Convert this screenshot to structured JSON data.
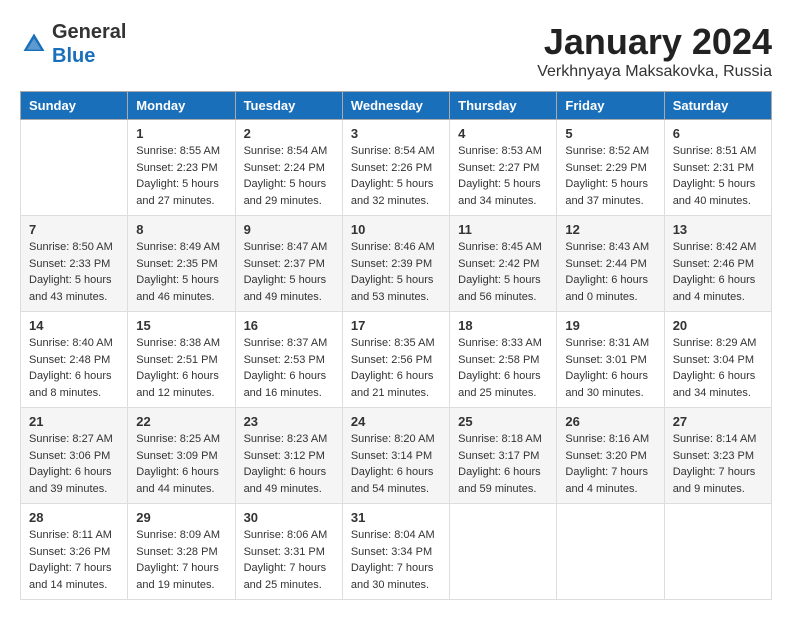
{
  "header": {
    "logo_line1": "General",
    "logo_line2": "Blue",
    "month": "January 2024",
    "location": "Verkhnyaya Maksakovka, Russia"
  },
  "weekdays": [
    "Sunday",
    "Monday",
    "Tuesday",
    "Wednesday",
    "Thursday",
    "Friday",
    "Saturday"
  ],
  "weeks": [
    [
      {
        "day": "",
        "sunrise": "",
        "sunset": "",
        "daylight": ""
      },
      {
        "day": "1",
        "sunrise": "Sunrise: 8:55 AM",
        "sunset": "Sunset: 2:23 PM",
        "daylight": "Daylight: 5 hours and 27 minutes."
      },
      {
        "day": "2",
        "sunrise": "Sunrise: 8:54 AM",
        "sunset": "Sunset: 2:24 PM",
        "daylight": "Daylight: 5 hours and 29 minutes."
      },
      {
        "day": "3",
        "sunrise": "Sunrise: 8:54 AM",
        "sunset": "Sunset: 2:26 PM",
        "daylight": "Daylight: 5 hours and 32 minutes."
      },
      {
        "day": "4",
        "sunrise": "Sunrise: 8:53 AM",
        "sunset": "Sunset: 2:27 PM",
        "daylight": "Daylight: 5 hours and 34 minutes."
      },
      {
        "day": "5",
        "sunrise": "Sunrise: 8:52 AM",
        "sunset": "Sunset: 2:29 PM",
        "daylight": "Daylight: 5 hours and 37 minutes."
      },
      {
        "day": "6",
        "sunrise": "Sunrise: 8:51 AM",
        "sunset": "Sunset: 2:31 PM",
        "daylight": "Daylight: 5 hours and 40 minutes."
      }
    ],
    [
      {
        "day": "7",
        "sunrise": "Sunrise: 8:50 AM",
        "sunset": "Sunset: 2:33 PM",
        "daylight": "Daylight: 5 hours and 43 minutes."
      },
      {
        "day": "8",
        "sunrise": "Sunrise: 8:49 AM",
        "sunset": "Sunset: 2:35 PM",
        "daylight": "Daylight: 5 hours and 46 minutes."
      },
      {
        "day": "9",
        "sunrise": "Sunrise: 8:47 AM",
        "sunset": "Sunset: 2:37 PM",
        "daylight": "Daylight: 5 hours and 49 minutes."
      },
      {
        "day": "10",
        "sunrise": "Sunrise: 8:46 AM",
        "sunset": "Sunset: 2:39 PM",
        "daylight": "Daylight: 5 hours and 53 minutes."
      },
      {
        "day": "11",
        "sunrise": "Sunrise: 8:45 AM",
        "sunset": "Sunset: 2:42 PM",
        "daylight": "Daylight: 5 hours and 56 minutes."
      },
      {
        "day": "12",
        "sunrise": "Sunrise: 8:43 AM",
        "sunset": "Sunset: 2:44 PM",
        "daylight": "Daylight: 6 hours and 0 minutes."
      },
      {
        "day": "13",
        "sunrise": "Sunrise: 8:42 AM",
        "sunset": "Sunset: 2:46 PM",
        "daylight": "Daylight: 6 hours and 4 minutes."
      }
    ],
    [
      {
        "day": "14",
        "sunrise": "Sunrise: 8:40 AM",
        "sunset": "Sunset: 2:48 PM",
        "daylight": "Daylight: 6 hours and 8 minutes."
      },
      {
        "day": "15",
        "sunrise": "Sunrise: 8:38 AM",
        "sunset": "Sunset: 2:51 PM",
        "daylight": "Daylight: 6 hours and 12 minutes."
      },
      {
        "day": "16",
        "sunrise": "Sunrise: 8:37 AM",
        "sunset": "Sunset: 2:53 PM",
        "daylight": "Daylight: 6 hours and 16 minutes."
      },
      {
        "day": "17",
        "sunrise": "Sunrise: 8:35 AM",
        "sunset": "Sunset: 2:56 PM",
        "daylight": "Daylight: 6 hours and 21 minutes."
      },
      {
        "day": "18",
        "sunrise": "Sunrise: 8:33 AM",
        "sunset": "Sunset: 2:58 PM",
        "daylight": "Daylight: 6 hours and 25 minutes."
      },
      {
        "day": "19",
        "sunrise": "Sunrise: 8:31 AM",
        "sunset": "Sunset: 3:01 PM",
        "daylight": "Daylight: 6 hours and 30 minutes."
      },
      {
        "day": "20",
        "sunrise": "Sunrise: 8:29 AM",
        "sunset": "Sunset: 3:04 PM",
        "daylight": "Daylight: 6 hours and 34 minutes."
      }
    ],
    [
      {
        "day": "21",
        "sunrise": "Sunrise: 8:27 AM",
        "sunset": "Sunset: 3:06 PM",
        "daylight": "Daylight: 6 hours and 39 minutes."
      },
      {
        "day": "22",
        "sunrise": "Sunrise: 8:25 AM",
        "sunset": "Sunset: 3:09 PM",
        "daylight": "Daylight: 6 hours and 44 minutes."
      },
      {
        "day": "23",
        "sunrise": "Sunrise: 8:23 AM",
        "sunset": "Sunset: 3:12 PM",
        "daylight": "Daylight: 6 hours and 49 minutes."
      },
      {
        "day": "24",
        "sunrise": "Sunrise: 8:20 AM",
        "sunset": "Sunset: 3:14 PM",
        "daylight": "Daylight: 6 hours and 54 minutes."
      },
      {
        "day": "25",
        "sunrise": "Sunrise: 8:18 AM",
        "sunset": "Sunset: 3:17 PM",
        "daylight": "Daylight: 6 hours and 59 minutes."
      },
      {
        "day": "26",
        "sunrise": "Sunrise: 8:16 AM",
        "sunset": "Sunset: 3:20 PM",
        "daylight": "Daylight: 7 hours and 4 minutes."
      },
      {
        "day": "27",
        "sunrise": "Sunrise: 8:14 AM",
        "sunset": "Sunset: 3:23 PM",
        "daylight": "Daylight: 7 hours and 9 minutes."
      }
    ],
    [
      {
        "day": "28",
        "sunrise": "Sunrise: 8:11 AM",
        "sunset": "Sunset: 3:26 PM",
        "daylight": "Daylight: 7 hours and 14 minutes."
      },
      {
        "day": "29",
        "sunrise": "Sunrise: 8:09 AM",
        "sunset": "Sunset: 3:28 PM",
        "daylight": "Daylight: 7 hours and 19 minutes."
      },
      {
        "day": "30",
        "sunrise": "Sunrise: 8:06 AM",
        "sunset": "Sunset: 3:31 PM",
        "daylight": "Daylight: 7 hours and 25 minutes."
      },
      {
        "day": "31",
        "sunrise": "Sunrise: 8:04 AM",
        "sunset": "Sunset: 3:34 PM",
        "daylight": "Daylight: 7 hours and 30 minutes."
      },
      {
        "day": "",
        "sunrise": "",
        "sunset": "",
        "daylight": ""
      },
      {
        "day": "",
        "sunrise": "",
        "sunset": "",
        "daylight": ""
      },
      {
        "day": "",
        "sunrise": "",
        "sunset": "",
        "daylight": ""
      }
    ]
  ]
}
